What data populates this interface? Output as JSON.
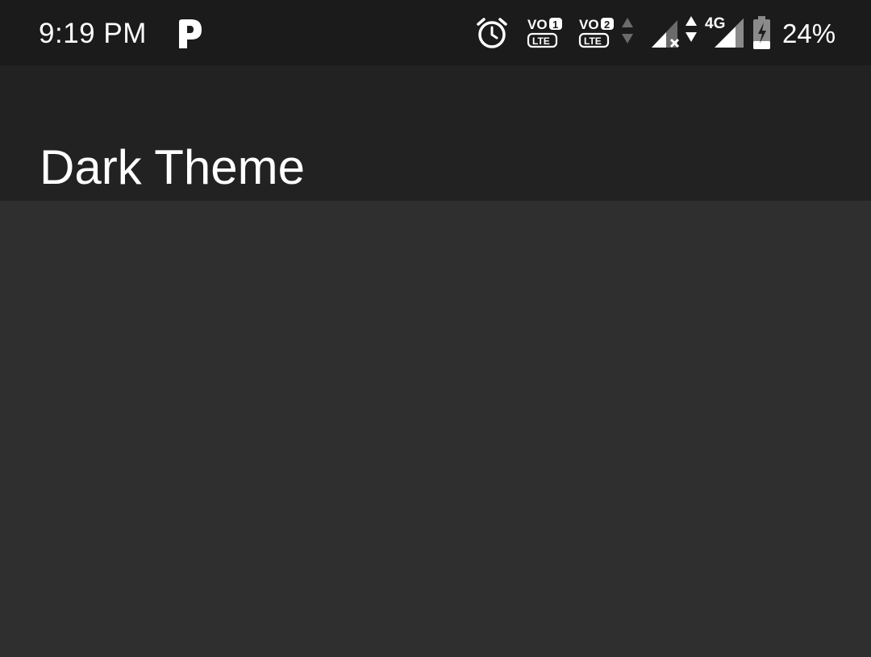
{
  "status_bar": {
    "time": "9:19 PM",
    "battery_percent": "24%",
    "sim1_badge": "1",
    "sim2_badge": "2",
    "volte_label": "VO",
    "lte_label": "LTE",
    "network_type": "4G",
    "icons": [
      "pandora-p-icon",
      "alarm-icon",
      "volte-sim1-icon",
      "volte-sim2-icon",
      "data-activity-icon",
      "signal-no-service-icon",
      "data-activity-4g-icon",
      "signal-4g-icon",
      "battery-charging-icon"
    ]
  },
  "app_bar": {
    "title": "Dark Theme"
  },
  "colors": {
    "status_bar_bg": "#1b1b1b",
    "app_bar_bg": "#222222",
    "content_bg": "#2f2f2f",
    "text": "#ffffff"
  }
}
